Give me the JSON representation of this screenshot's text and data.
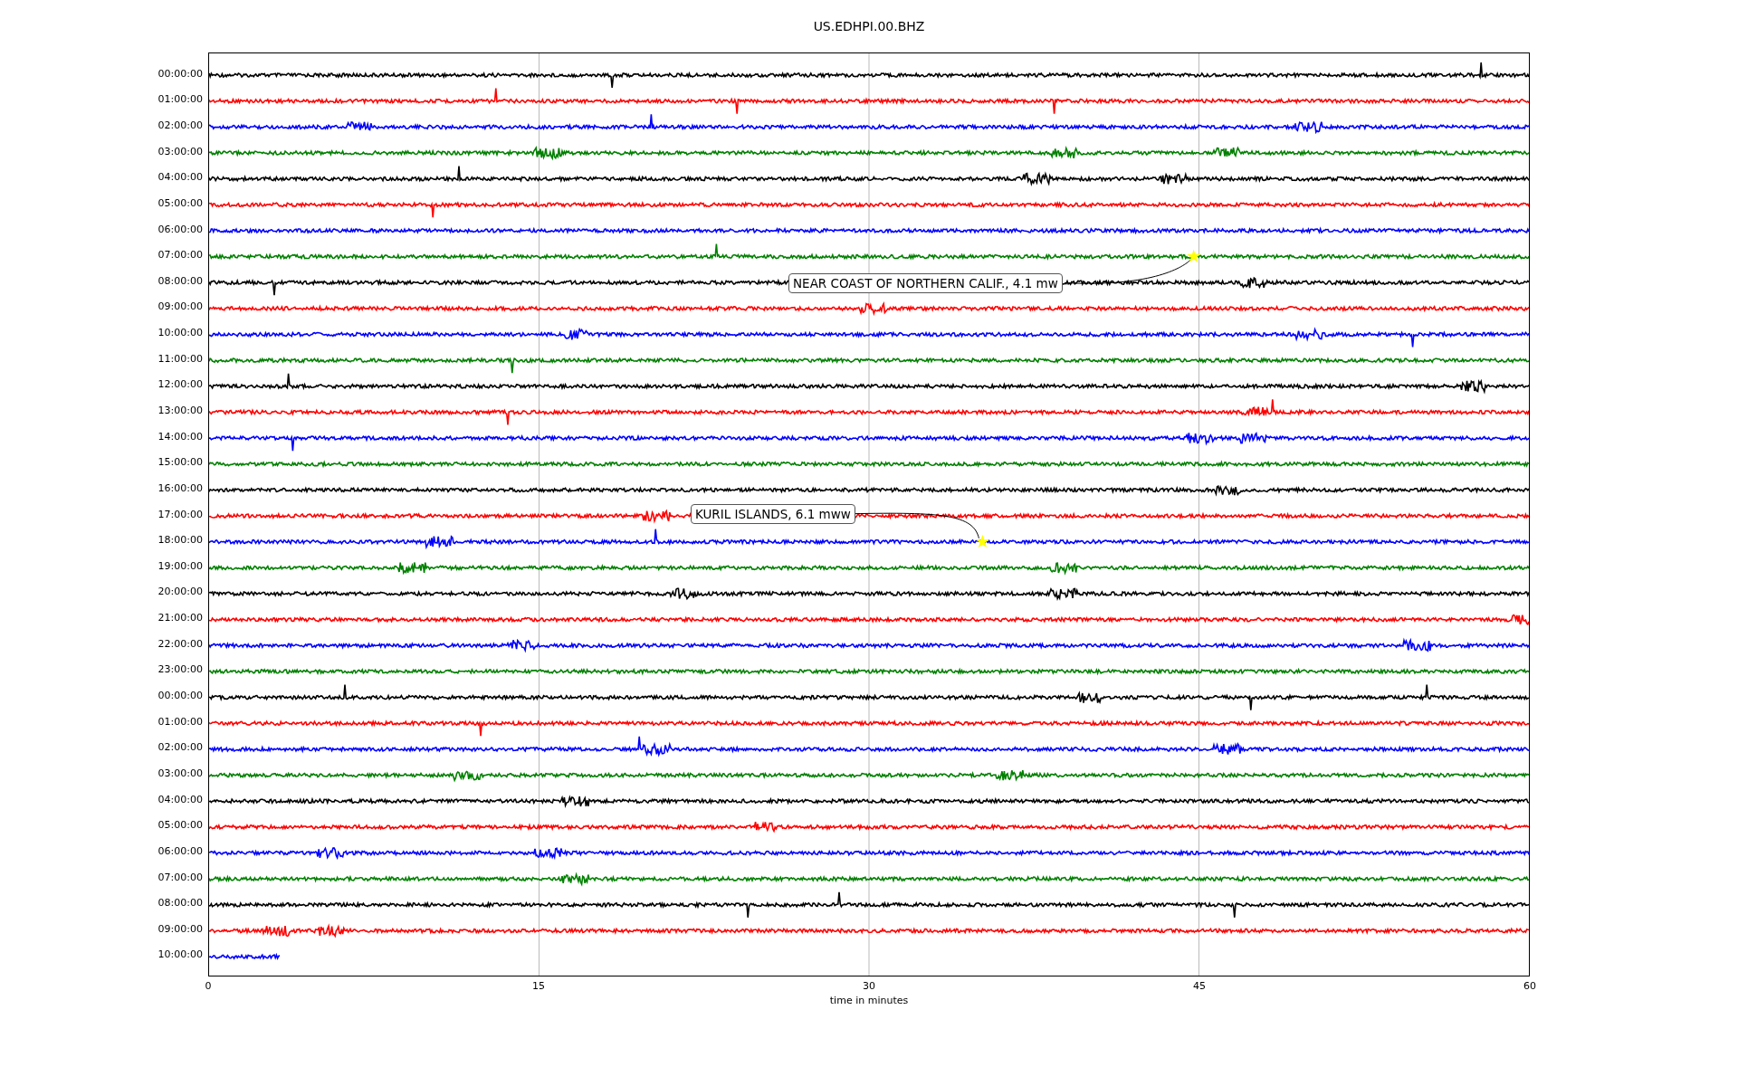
{
  "title": "US.EDHPI.00.BHZ",
  "rows": [
    {
      "label": "00:00:00",
      "color": "#000000"
    },
    {
      "label": "01:00:00",
      "color": "#ff0000"
    },
    {
      "label": "02:00:00",
      "color": "#0000ff"
    },
    {
      "label": "03:00:00",
      "color": "#008000"
    },
    {
      "label": "04:00:00",
      "color": "#000000"
    },
    {
      "label": "05:00:00",
      "color": "#ff0000"
    },
    {
      "label": "06:00:00",
      "color": "#0000ff"
    },
    {
      "label": "07:00:00",
      "color": "#008000",
      "event": "NEAR COAST OF NORTHERN CALIF., 4.1 mw"
    },
    {
      "label": "08:00:00",
      "color": "#000000"
    },
    {
      "label": "09:00:00",
      "color": "#ff0000"
    },
    {
      "label": "10:00:00",
      "color": "#0000ff"
    },
    {
      "label": "11:00:00",
      "color": "#008000"
    },
    {
      "label": "12:00:00",
      "color": "#000000"
    },
    {
      "label": "13:00:00",
      "color": "#ff0000"
    },
    {
      "label": "14:00:00",
      "color": "#0000ff"
    },
    {
      "label": "15:00:00",
      "color": "#008000"
    },
    {
      "label": "16:00:00",
      "color": "#000000"
    },
    {
      "label": "17:00:00",
      "color": "#ff0000"
    },
    {
      "label": "18:00:00",
      "color": "#0000ff",
      "event": "KURIL ISLANDS, 6.1 mww"
    },
    {
      "label": "19:00:00",
      "color": "#008000"
    },
    {
      "label": "20:00:00",
      "color": "#000000"
    },
    {
      "label": "21:00:00",
      "color": "#ff0000"
    },
    {
      "label": "22:00:00",
      "color": "#0000ff"
    },
    {
      "label": "23:00:00",
      "color": "#008000"
    },
    {
      "label": "00:00:00",
      "color": "#000000"
    },
    {
      "label": "01:00:00",
      "color": "#ff0000"
    },
    {
      "label": "02:00:00",
      "color": "#0000ff"
    },
    {
      "label": "03:00:00",
      "color": "#008000"
    },
    {
      "label": "04:00:00",
      "color": "#000000"
    },
    {
      "label": "05:00:00",
      "color": "#ff0000"
    },
    {
      "label": "06:00:00",
      "color": "#0000ff"
    },
    {
      "label": "07:00:00",
      "color": "#008000"
    },
    {
      "label": "08:00:00",
      "color": "#000000"
    },
    {
      "label": "09:00:00",
      "color": "#ff0000"
    },
    {
      "label": "10:00:00",
      "color": "#0000ff",
      "level": 0.054
    }
  ],
  "xticks": [
    "0",
    "15",
    "30",
    "45",
    "60"
  ],
  "xlabel": "time in minutes"
}
